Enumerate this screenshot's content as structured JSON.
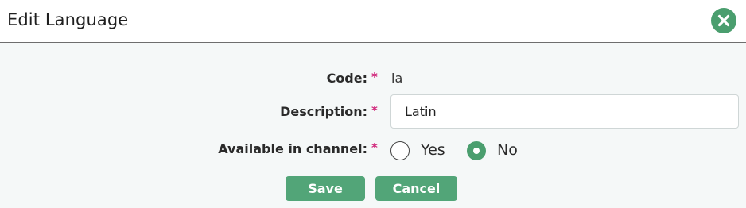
{
  "dialog": {
    "title": "Edit Language",
    "close_icon": "close-icon",
    "accent_color": "#4a9e6e"
  },
  "form": {
    "required_marker": "*",
    "code": {
      "label": "Code:",
      "value": "la"
    },
    "description": {
      "label": "Description:",
      "value": "Latin"
    },
    "available": {
      "label": "Available in channel:",
      "options": [
        "Yes",
        "No"
      ],
      "selected": "No"
    }
  },
  "buttons": {
    "save_label": "Save",
    "cancel_label": "Cancel"
  }
}
